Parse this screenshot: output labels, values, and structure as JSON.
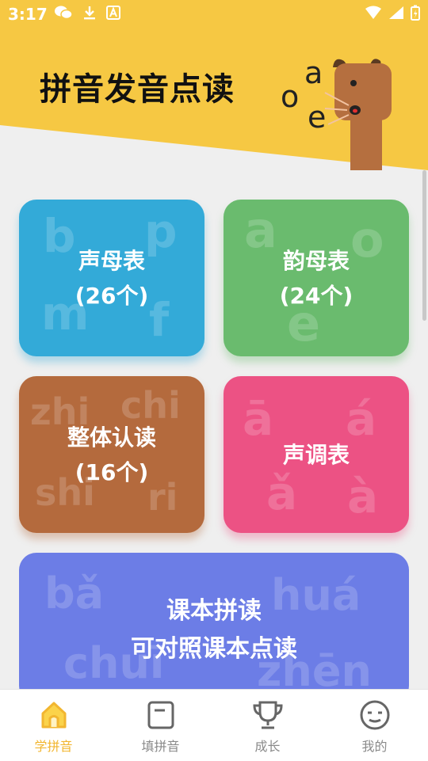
{
  "status_bar": {
    "time": "3:17",
    "left_icons": [
      "wechat-icon",
      "download-icon",
      "a-badge-icon"
    ],
    "right_icons": [
      "wifi-icon",
      "signal-icon",
      "battery-icon"
    ]
  },
  "header": {
    "title": "拼音发音点读",
    "mascot_letters": [
      "a",
      "o",
      "e"
    ]
  },
  "cards": [
    {
      "title": "声母表",
      "count": "(26个)",
      "bg_letters": [
        "b",
        "p",
        "m",
        "f"
      ],
      "color": "#33aad8"
    },
    {
      "title": "韵母表",
      "count": "(24个)",
      "bg_letters": [
        "a",
        "o",
        "e"
      ],
      "color": "#6abb6e"
    },
    {
      "title": "整体认读",
      "count": "(16个)",
      "bg_letters": [
        "zhi",
        "chi",
        "shi",
        "ri"
      ],
      "color": "#b46a3d"
    },
    {
      "title": "声调表",
      "count": "",
      "bg_letters": [
        "ā",
        "á",
        "ǎ",
        "à"
      ],
      "color": "#ec5284"
    },
    {
      "title": "课本拼读",
      "subtitle": "可对照课本点读",
      "bg_letters": [
        "bǎ",
        "huá",
        "chuī",
        "zhēn"
      ],
      "color": "#6c7de6"
    }
  ],
  "tabs": [
    {
      "label": "学拼音",
      "icon": "house-icon",
      "active": true
    },
    {
      "label": "填拼音",
      "icon": "note-icon",
      "active": false
    },
    {
      "label": "成长",
      "icon": "trophy-icon",
      "active": false
    },
    {
      "label": "我的",
      "icon": "face-icon",
      "active": false
    }
  ],
  "colors": {
    "accent_yellow": "#f6c843",
    "tab_active": "#f2b630"
  }
}
